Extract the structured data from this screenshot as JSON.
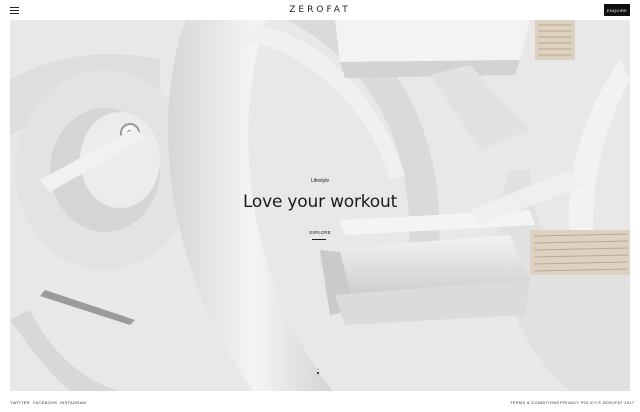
{
  "header": {
    "logo": "ZEROFAT",
    "enquire_label": "ENQUIRE"
  },
  "hero": {
    "category": "Lifestyle",
    "title": "Love your workout",
    "cta": "EXPLORE",
    "slides": {
      "count": 2,
      "active": 2
    }
  },
  "footer": {
    "social": [
      "TWITTER",
      "FACEBOOK",
      "INSTAGRAM"
    ],
    "legal": [
      "TERMS & CONDITIONS",
      "PRIVACY POLICY"
    ],
    "copyright": "© ZEROFAT 2017"
  },
  "colors": {
    "background": "#e9e8e8",
    "text": "#1a1a1a",
    "button": "#111111"
  },
  "icons": {
    "menu": "hamburger-icon"
  }
}
